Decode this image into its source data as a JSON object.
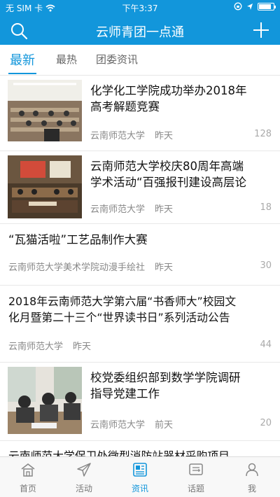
{
  "status_bar": {
    "carrier": "无 SIM 卡",
    "time": "下午3:37",
    "battery_level": 0.85
  },
  "header": {
    "title": "云师青团一点通"
  },
  "tabs": [
    {
      "label": "最新"
    },
    {
      "label": "最热"
    },
    {
      "label": "团委资讯"
    }
  ],
  "news": [
    {
      "title_line1": "化学化工学院成功举办2018年",
      "title_line2": "高考解题竞赛",
      "source": "云南师范大学",
      "time": "昨天",
      "count": "128"
    },
    {
      "title_line1": "云南师范大学校庆80周年高端",
      "title_line2": "学术活动“百强报刊建设高层论",
      "source": "云南师范大学",
      "time": "昨天",
      "count": "18"
    },
    {
      "title_line1": "“瓦猫活啦”工艺品制作大赛",
      "source": "云南师范大学美术学院动漫手绘社",
      "time": "昨天",
      "count": "30"
    },
    {
      "title_line1": "2018年云南师范大学第六届“书香师大”校园文",
      "title_line2": "化月暨第二十三个“世界读书日”系列活动公告",
      "source": "云南师范大学",
      "time": "昨天",
      "count": "44"
    },
    {
      "title_line1": "校党委组织部到数学学院调研",
      "title_line2": "指导党建工作",
      "source": "云南师范大学",
      "time": "前天",
      "count": "20"
    },
    {
      "title_line1": "云南师范大学保卫处微型消防站器材采购项目"
    }
  ],
  "tab_bar": [
    {
      "label": "首页",
      "icon": "home-icon"
    },
    {
      "label": "活动",
      "icon": "paper-plane-icon"
    },
    {
      "label": "资讯",
      "icon": "news-icon"
    },
    {
      "label": "话题",
      "icon": "topic-icon"
    },
    {
      "label": "我",
      "icon": "person-icon"
    }
  ],
  "colors": {
    "brand": "#1296db"
  }
}
